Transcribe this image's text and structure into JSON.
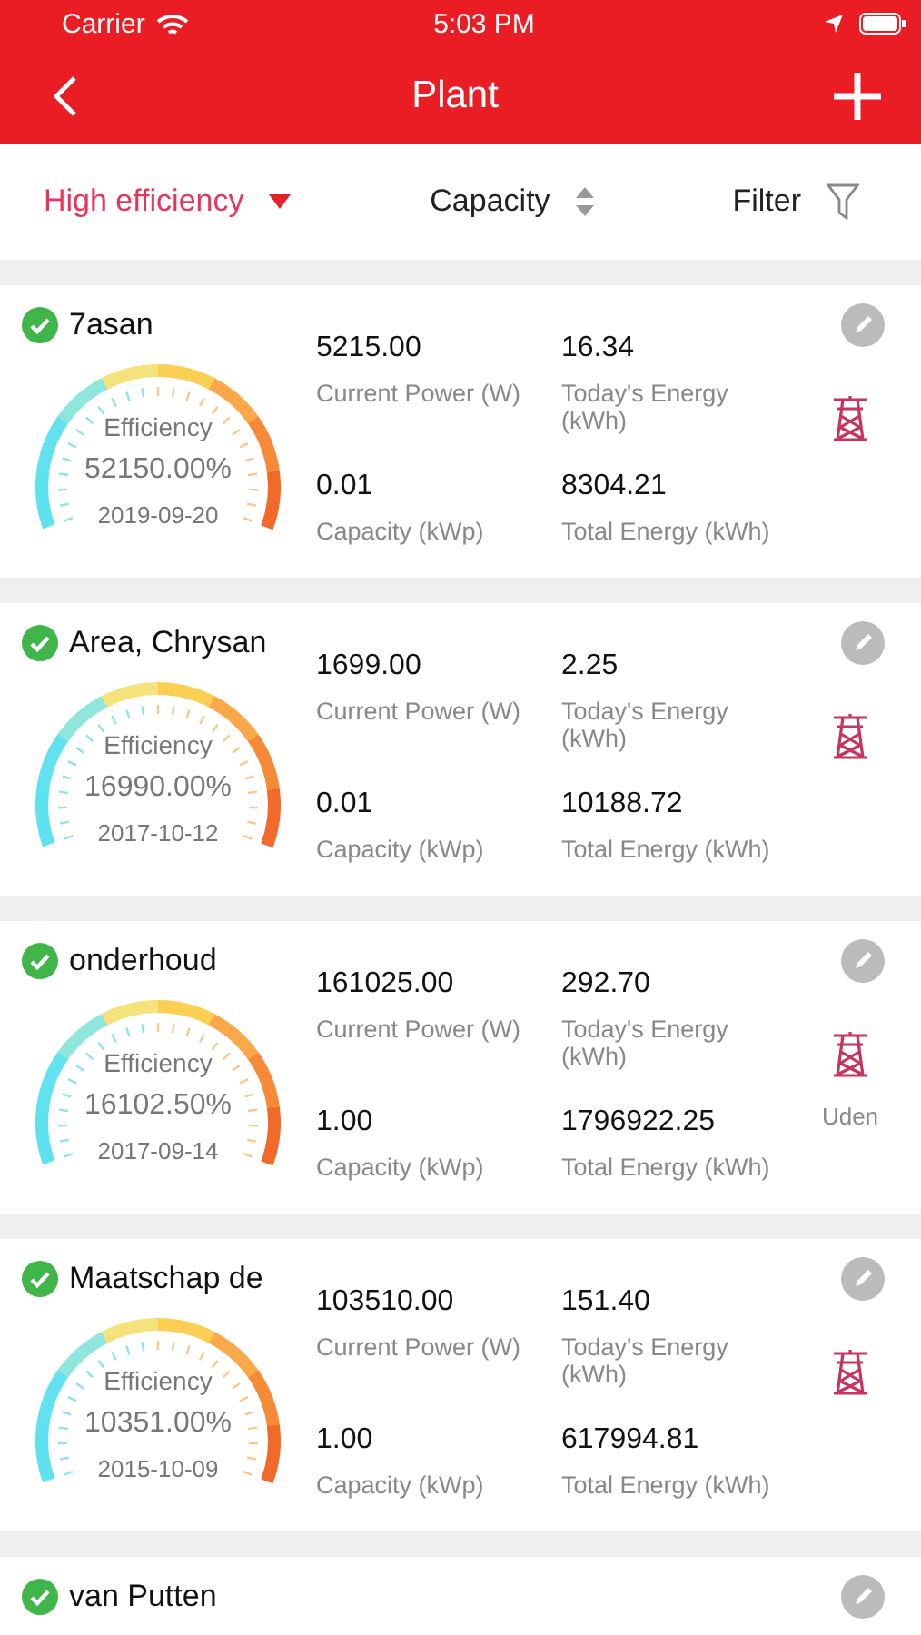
{
  "status_bar": {
    "carrier": "Carrier",
    "time": "5:03 PM"
  },
  "nav": {
    "title": "Plant"
  },
  "sort_bar": [
    {
      "label": "High efficiency",
      "selected": true,
      "kind": "dropdown"
    },
    {
      "label": "Capacity",
      "selected": false,
      "kind": "sort"
    },
    {
      "label": "Filter",
      "selected": false,
      "kind": "filter"
    }
  ],
  "plants": [
    {
      "name": "7asan",
      "online": true,
      "efficiency_label": "Efficiency",
      "efficiency": "52150.00%",
      "date": "2019-09-20",
      "current_power": "5215.00",
      "current_power_label": "Current Power (W)",
      "todays_energy": "16.34",
      "todays_energy_label": "Today's Energy (kWh)",
      "capacity": "0.01",
      "capacity_label": "Capacity (kWp)",
      "total_energy": "8304.21",
      "total_energy_label": "Total Energy (kWh)"
    },
    {
      "name": "Area, Chrysan",
      "online": true,
      "efficiency_label": "Efficiency",
      "efficiency": "16990.00%",
      "date": "2017-10-12",
      "current_power": "1699.00",
      "current_power_label": "Current Power (W)",
      "todays_energy": "2.25",
      "todays_energy_label": "Today's Energy (kWh)",
      "capacity": "0.01",
      "capacity_label": "Capacity (kWp)",
      "total_energy": "10188.72",
      "total_energy_label": "Total Energy (kWh)"
    },
    {
      "name": "onderhoud",
      "online": true,
      "efficiency_label": "Efficiency",
      "efficiency": "16102.50%",
      "date": "2017-09-14",
      "current_power": "161025.00",
      "current_power_label": "Current Power (W)",
      "todays_energy": "292.70",
      "todays_energy_label": "Today's Energy (kWh)",
      "capacity": "1.00",
      "capacity_label": "Capacity (kWp)",
      "total_energy": "1796922.25",
      "total_energy_label": "Total Energy (kWh)",
      "location": "Uden"
    },
    {
      "name": "Maatschap de",
      "online": true,
      "efficiency_label": "Efficiency",
      "efficiency": "10351.00%",
      "date": "2015-10-09",
      "current_power": "103510.00",
      "current_power_label": "Current Power (W)",
      "todays_energy": "151.40",
      "todays_energy_label": "Today's Energy (kWh)",
      "capacity": "1.00",
      "capacity_label": "Capacity (kWp)",
      "total_energy": "617994.81",
      "total_energy_label": "Total Energy (kWh)"
    },
    {
      "name": "van Putten",
      "online": true
    }
  ]
}
